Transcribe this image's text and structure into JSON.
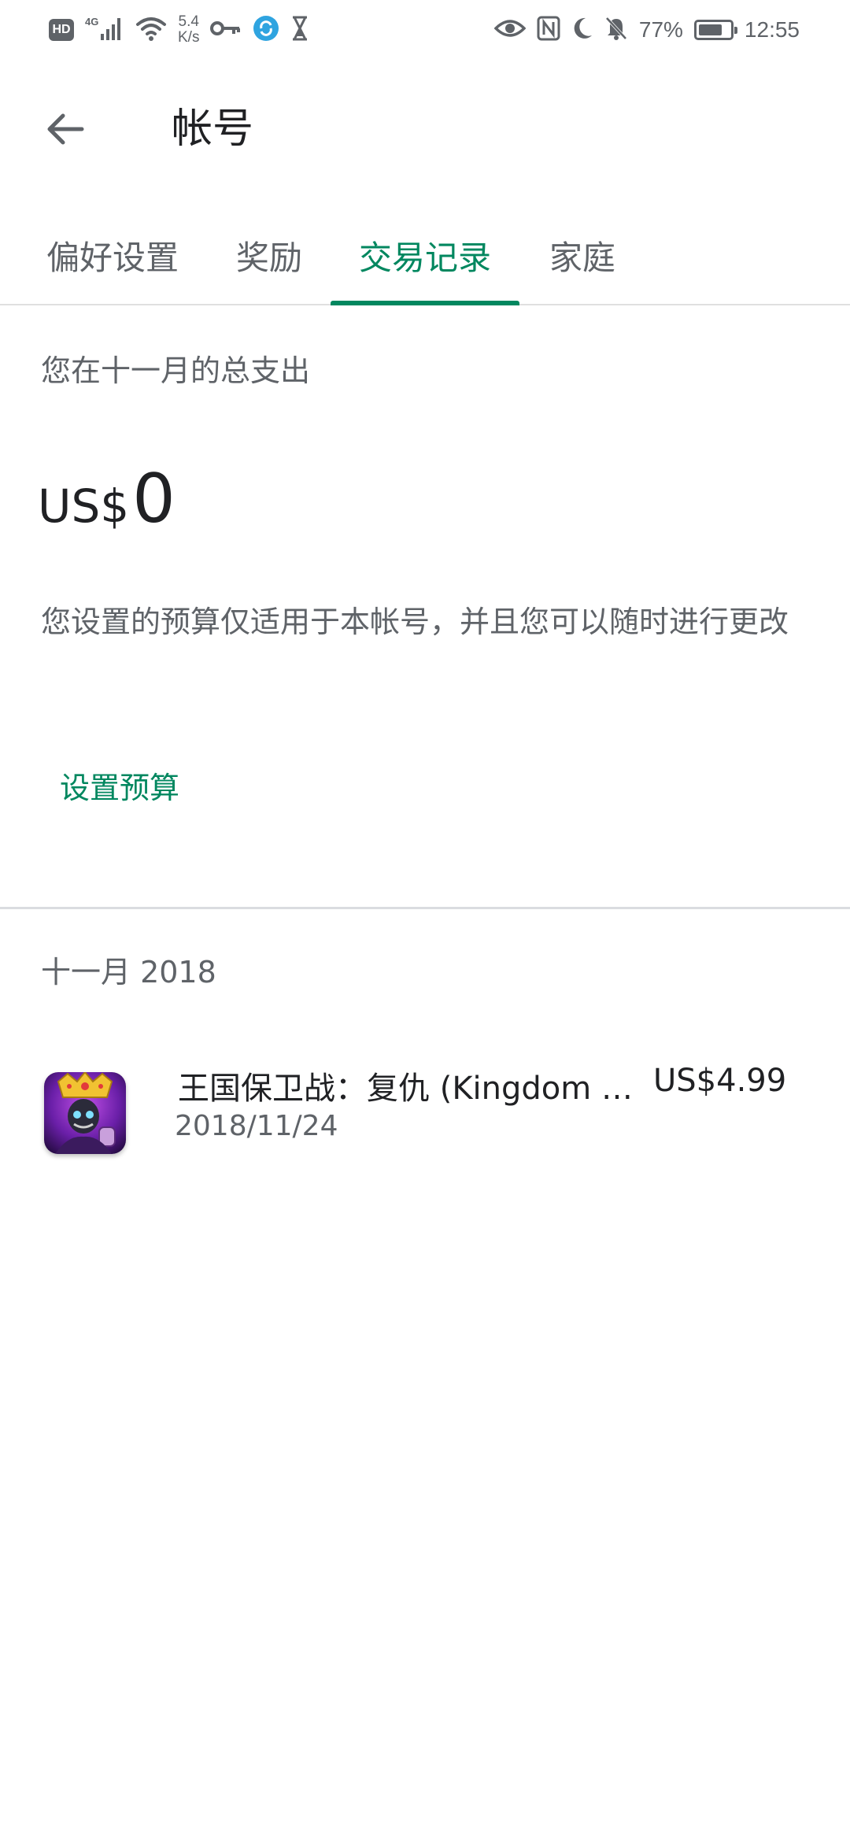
{
  "status_bar": {
    "hd": "HD",
    "network": "4G",
    "speed_value": "5.4",
    "speed_unit": "K/s",
    "battery": "77%",
    "battery_level": 0.77,
    "time": "12:55",
    "icons": [
      "hd-icon",
      "signal-icon",
      "wifi-icon",
      "key-icon",
      "vpn-icon",
      "hourglass-icon",
      "eye-icon",
      "nfc-icon",
      "moon-icon",
      "bell-off-icon",
      "battery-icon"
    ]
  },
  "appbar": {
    "title": "帐号"
  },
  "tabs": [
    {
      "label": "偏好设置",
      "active": false
    },
    {
      "label": "奖励",
      "active": false
    },
    {
      "label": "交易记录",
      "active": true
    },
    {
      "label": "家庭",
      "active": false
    }
  ],
  "summary": {
    "label": "您在十一月的总支出",
    "currency": "US$",
    "amount": "0",
    "note": "您设置的预算仅适用于本帐号，并且您可以随时进行更改",
    "budget_button": "设置预算"
  },
  "history": {
    "month": "十一月 2018",
    "items": [
      {
        "title": "王国保卫战：复仇 (Kingdom Rush Vengeance)",
        "date": "2018/11/24",
        "price": "US$4.99"
      }
    ]
  },
  "colors": {
    "accent": "#01875f",
    "text_primary": "#202124",
    "text_secondary": "#5f6368",
    "divider": "#dadce0"
  }
}
